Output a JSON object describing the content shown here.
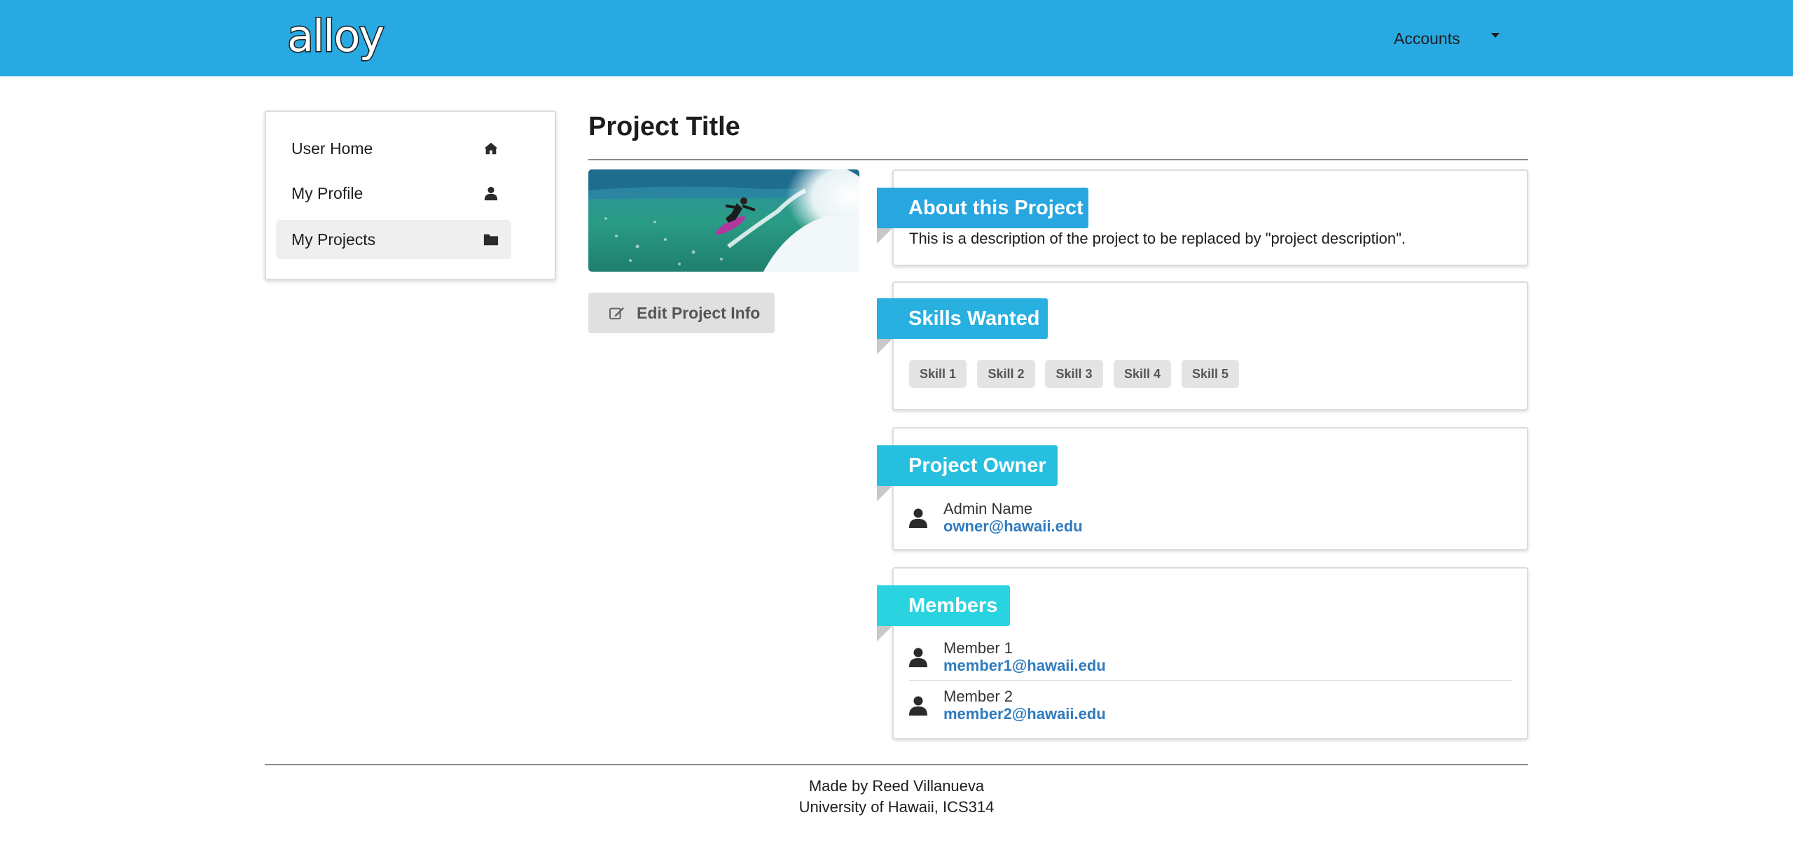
{
  "header": {
    "logo_text": "alloy",
    "accounts_label": "Accounts",
    "brand_color": "#29a9e2"
  },
  "sidebar": {
    "items": [
      {
        "label": "User Home",
        "icon": "home-icon"
      },
      {
        "label": "My Profile",
        "icon": "user-icon"
      },
      {
        "label": "My Projects",
        "icon": "folder-icon",
        "active": true
      }
    ]
  },
  "project": {
    "title": "Project Title",
    "image_icon": "surfer-photo",
    "edit_label": "Edit Project Info"
  },
  "about": {
    "heading": "About this Project",
    "description": "This is a description of the project to be replaced by \"project description\"."
  },
  "skills": {
    "heading": "Skills Wanted",
    "tags": [
      "Skill 1",
      "Skill 2",
      "Skill 3",
      "Skill 4",
      "Skill 5"
    ]
  },
  "owner": {
    "heading": "Project Owner",
    "name": "Admin Name",
    "email": "owner@hawaii.edu"
  },
  "members": {
    "heading": "Members",
    "list": [
      {
        "name": "Member 1",
        "email": "member1@hawaii.edu"
      },
      {
        "name": "Member 2",
        "email": "member2@hawaii.edu"
      }
    ]
  },
  "footer": {
    "line1": "Made by Reed Villanueva",
    "line2": "University of Hawaii, ICS314"
  },
  "colors": {
    "ribbon_about": "#27a6e0",
    "ribbon_skills": "#28b0e0",
    "ribbon_owner": "#27bfe0",
    "ribbon_members": "#2ad3e0",
    "link": "#2f7bbf"
  }
}
